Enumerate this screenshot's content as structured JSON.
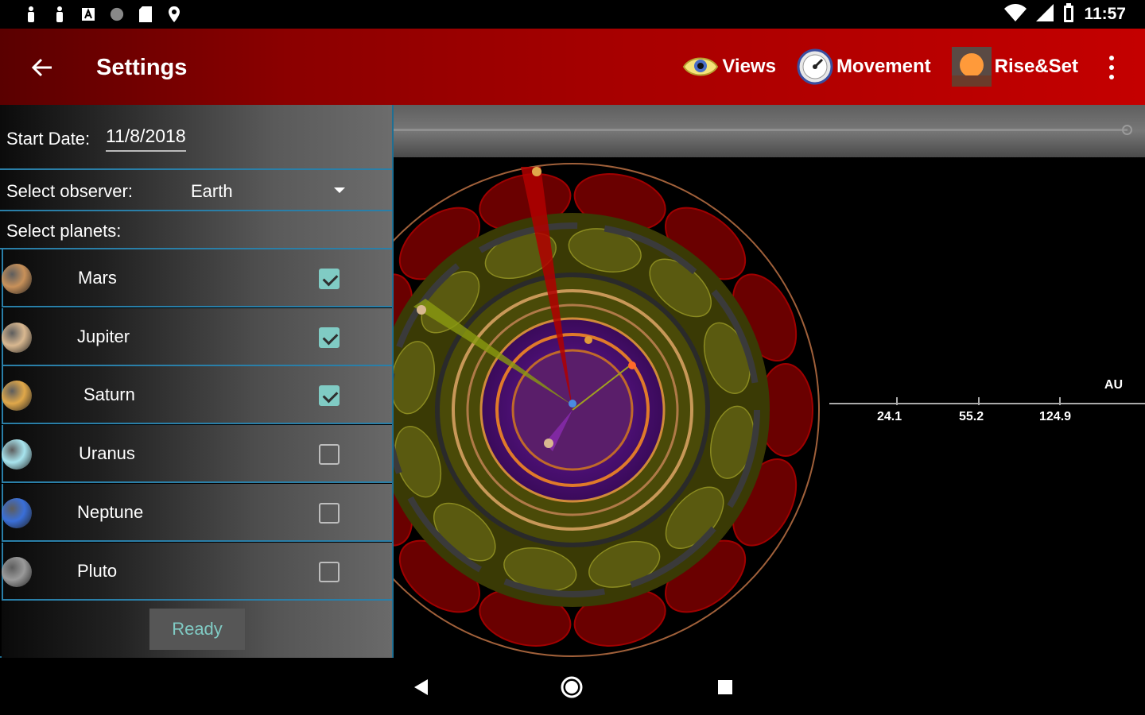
{
  "status_bar": {
    "time": "11:57",
    "icons": [
      "person-icon",
      "person-icon",
      "a-icon",
      "circle-icon",
      "sd-card-icon",
      "location-icon"
    ],
    "right_icons": [
      "wifi-icon",
      "signal-icon",
      "battery-icon"
    ]
  },
  "app_bar": {
    "title": "Settings",
    "back_icon": "back-arrow-icon",
    "actions": [
      {
        "label": "Views",
        "icon": "eye-icon"
      },
      {
        "label": "Movement",
        "icon": "speedometer-icon"
      },
      {
        "label": "Rise&Set",
        "icon": "sun-icon"
      }
    ],
    "overflow_icon": "more-vert-icon"
  },
  "settings": {
    "start_date_label": "Start Date:",
    "start_date_value": "11/8/2018",
    "observer_label": "Select observer:",
    "observer_value": "Earth",
    "planets_label": "Select planets:",
    "planets": [
      {
        "name": "Mars",
        "checked": true,
        "color": "#c8915a"
      },
      {
        "name": "Jupiter",
        "checked": true,
        "color": "#d9b890"
      },
      {
        "name": "Saturn",
        "checked": true,
        "color": "#e0a84a"
      },
      {
        "name": "Uranus",
        "checked": false,
        "color": "#a8e4ee"
      },
      {
        "name": "Neptune",
        "checked": false,
        "color": "#3a6fd8"
      },
      {
        "name": "Pluto",
        "checked": false,
        "color": "#9a9a9a"
      }
    ],
    "ready_label": "Ready"
  },
  "scale_axis": {
    "ticks": [
      "24.1",
      "55.2",
      "124.9"
    ],
    "unit": "AU"
  },
  "colors": {
    "accent": "#80cbc4",
    "divider": "#2a7fa8",
    "appbar_red": "#c40000"
  },
  "nav_bar": {
    "icons": [
      "nav-back-icon",
      "nav-home-icon",
      "nav-recents-icon"
    ]
  }
}
